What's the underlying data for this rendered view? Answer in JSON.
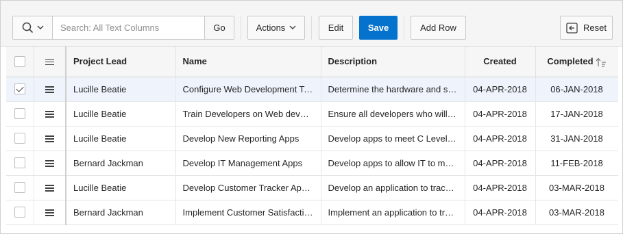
{
  "toolbar": {
    "search_placeholder": "Search: All Text Columns",
    "search_value": "",
    "go_label": "Go",
    "actions_label": "Actions",
    "edit_label": "Edit",
    "save_label": "Save",
    "add_row_label": "Add Row",
    "reset_label": "Reset"
  },
  "grid": {
    "columns": {
      "project_lead": "Project Lead",
      "name": "Name",
      "description": "Description",
      "created": "Created",
      "completed": "Completed"
    },
    "rows": [
      {
        "selected": true,
        "project_lead": "Lucille Beatie",
        "name": "Configure Web Development Tools",
        "description": "Determine the hardware and software required",
        "created": "04-APR-2018",
        "completed": "06-JAN-2018"
      },
      {
        "selected": false,
        "project_lead": "Lucille Beatie",
        "name": "Train Developers on Web development tools",
        "description": "Ensure all developers who will be using the tools",
        "created": "04-APR-2018",
        "completed": "17-JAN-2018"
      },
      {
        "selected": false,
        "project_lead": "Lucille Beatie",
        "name": "Develop New Reporting Apps",
        "description": "Develop apps to meet C Level reporting requirements",
        "created": "04-APR-2018",
        "completed": "31-JAN-2018"
      },
      {
        "selected": false,
        "project_lead": "Bernard Jackman",
        "name": "Develop IT Management Apps",
        "description": "Develop apps to allow IT to manage",
        "created": "04-APR-2018",
        "completed": "11-FEB-2018"
      },
      {
        "selected": false,
        "project_lead": "Lucille Beatie",
        "name": "Develop Customer Tracker Application",
        "description": "Develop an application to track customers",
        "created": "04-APR-2018",
        "completed": "03-MAR-2018"
      },
      {
        "selected": false,
        "project_lead": "Bernard Jackman",
        "name": "Implement Customer Satisfaction Survey",
        "description": "Implement an application to track satisfaction",
        "created": "04-APR-2018",
        "completed": "03-MAR-2018"
      }
    ]
  },
  "colors": {
    "primary": "#0572ce",
    "selected_row": "#eef3fc",
    "header_bg": "#f6f6f6"
  }
}
